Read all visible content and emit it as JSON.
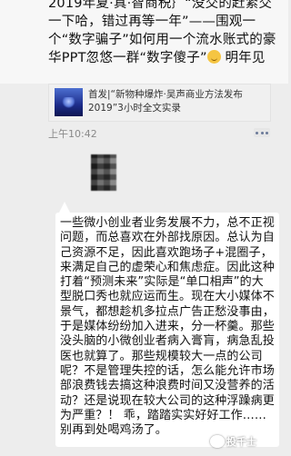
{
  "top_message": {
    "text": "2019年夏·真·智商税｝“没交的赶紧交一下哈，错过再等一年”——围观一个“数字骗子”如何用一个流水账式的豪华PPT忽悠一群“数字傻子”",
    "text_after_emoji": " 明年见",
    "emoji": "smile-emoji"
  },
  "link_card": {
    "title": "首发|“新物种爆炸·吴声商业方法发布2019”3小时全文实录"
  },
  "timestamp": "上午10:42",
  "reply": {
    "text": "一些微小创业者业务发展不力，总不正视问题，而总喜欢在外部找原因。总认为自己资源不足，因此喜欢跑场子+混圈子，来满足自己的虚荣心和焦虑症。因此这种打着“预测未来”实际是“单口相声”的大型脱口秀也就应运而生。现在大小媒体不景气，都想趁机多拉点广告正愁没事由，于是媒体纷纷加入进来，分一杯羹。那些没头脑的小微创业者病入膏肓，病急乱投医也就算了。那些规模较大一点的公司呢？不是管理失控的话，怎么能允许市场部浪费钱去搞这种浪费时间又没营养的活动？还是说现在较大公司的这种浮躁病更为严重？！ 乖，踏踏实实好好工作……别再到处喝鸡汤了。"
  },
  "watermark": "投千士"
}
